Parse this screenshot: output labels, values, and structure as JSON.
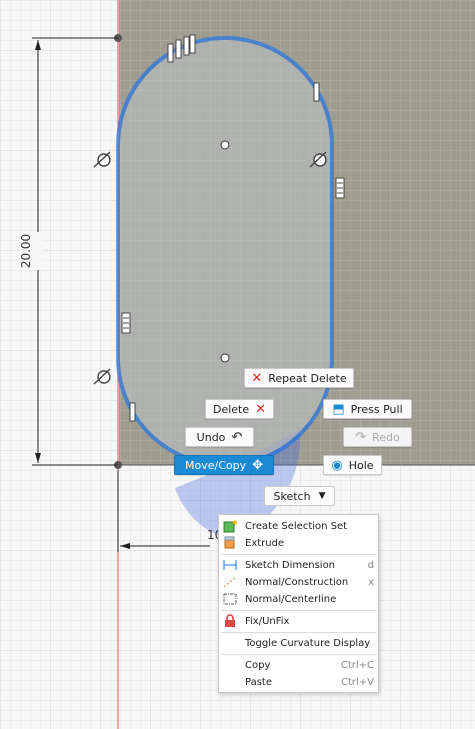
{
  "dimension": {
    "vertical": "20.00",
    "horizontal_partial": "10"
  },
  "buttons": {
    "repeat_delete": "Repeat Delete",
    "delete": "Delete",
    "press_pull": "Press Pull",
    "undo": "Undo",
    "redo": "Redo",
    "move_copy": "Move/Copy",
    "hole": "Hole",
    "sketch": "Sketch"
  },
  "menu": {
    "create_selection_set": "Create Selection Set",
    "extrude": "Extrude",
    "sketch_dimension": "Sketch Dimension",
    "sketch_dimension_shortcut": "d",
    "normal_construction": "Normal/Construction",
    "normal_construction_shortcut": "x",
    "normal_centerline": "Normal/Centerline",
    "fix_unfix": "Fix/UnFix",
    "toggle_curvature": "Toggle Curvature Display",
    "copy": "Copy",
    "copy_shortcut": "Ctrl+C",
    "paste": "Paste",
    "paste_shortcut": "Ctrl+V"
  },
  "colors": {
    "profile_fill": "#b9bdbf",
    "shaded_region": "#8f8c7e",
    "sketch_line": "#1a73e8",
    "accent": "#1a8ad4",
    "delete_red": "#e0262a"
  }
}
